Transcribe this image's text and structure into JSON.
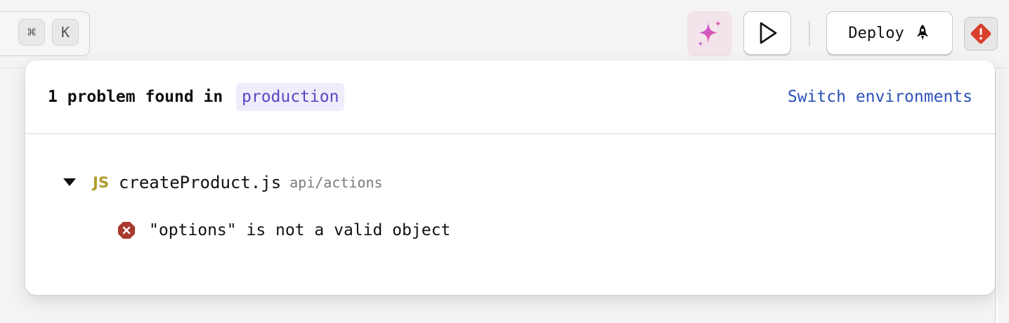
{
  "toolbar": {
    "shortcut_keys": [
      "⌘",
      "K"
    ],
    "deploy_label": "Deploy",
    "icons": {
      "ai": "sparkle-icon",
      "run": "play-icon",
      "deploy": "rocket-icon",
      "problems": "warning-diamond-icon"
    },
    "colors": {
      "ai_gradient_start": "#b85cf0",
      "ai_gradient_end": "#f0508a",
      "problems": "#d8402e"
    }
  },
  "problems_popover": {
    "title": "1 problem found in",
    "environment": "production",
    "switch_link": "Switch environments",
    "files": [
      {
        "type_label": "JS",
        "name": "createProduct.js",
        "path": "api/actions",
        "expanded": true,
        "errors": [
          {
            "message": "\"options\" is not a valid object"
          }
        ]
      }
    ],
    "colors": {
      "environment_text": "#5b46c4",
      "environment_bg": "#f0ecfb",
      "link": "#2c52b8",
      "js_badge": "#b19a2a",
      "error": "#a83a2e"
    }
  }
}
